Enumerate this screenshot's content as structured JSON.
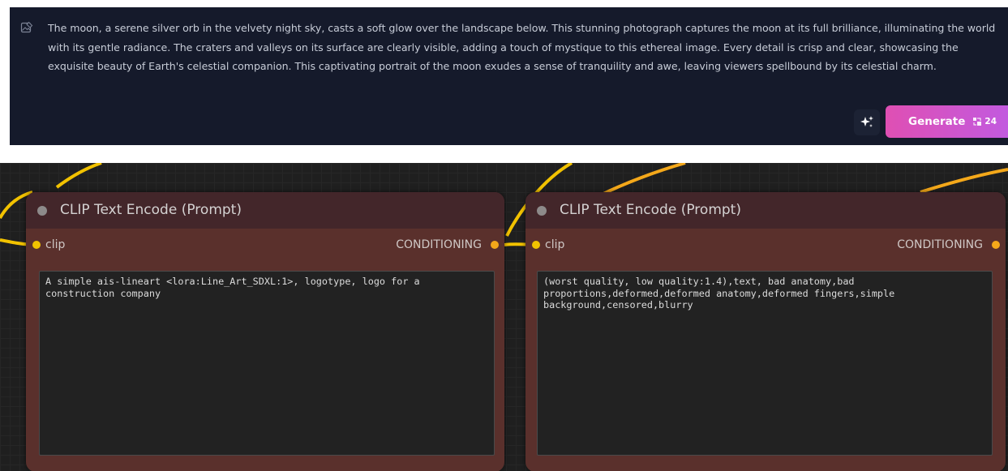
{
  "prompt_panel": {
    "text": "The moon, a serene silver orb in the velvety night sky, casts a soft glow over the landscape below. This stunning photograph captures the moon at its full brilliance, illuminating the world with its gentle radiance. The craters and valleys on its surface are clearly visible, adding a touch of mystique to this ethereal image. Every detail is crisp and clear, showcasing the exquisite beauty of Earth's celestial companion. This captivating portrait of the moon exudes a sense of tranquility and awe, leaving viewers spellbound by its celestial charm.",
    "magic_icon": "sparkle-icon",
    "generate_label": "Generate",
    "credit_icon": "credit-icon",
    "credit_count": "24"
  },
  "nodes": [
    {
      "title": "CLIP Text Encode (Prompt)",
      "input_label": "clip",
      "output_label": "CONDITIONING",
      "text": "A simple ais-lineart <lora:Line_Art_SDXL:1>, logotype, logo for a construction company"
    },
    {
      "title": "CLIP Text Encode (Prompt)",
      "input_label": "clip",
      "output_label": "CONDITIONING",
      "text": "(worst quality, low quality:1.4),text, bad anatomy,bad proportions,deformed,deformed anatomy,deformed fingers,simple background,censored,blurry"
    }
  ],
  "colors": {
    "panel_bg": "#151a2b",
    "generate_gradient_start": "#df4fb3",
    "generate_gradient_end": "#c25adf",
    "node_body": "#5a302c",
    "node_header": "#43262a",
    "clip_slot": "#f2c200",
    "conditioning_slot": "#f4a81a",
    "wire": "#f2c200"
  }
}
